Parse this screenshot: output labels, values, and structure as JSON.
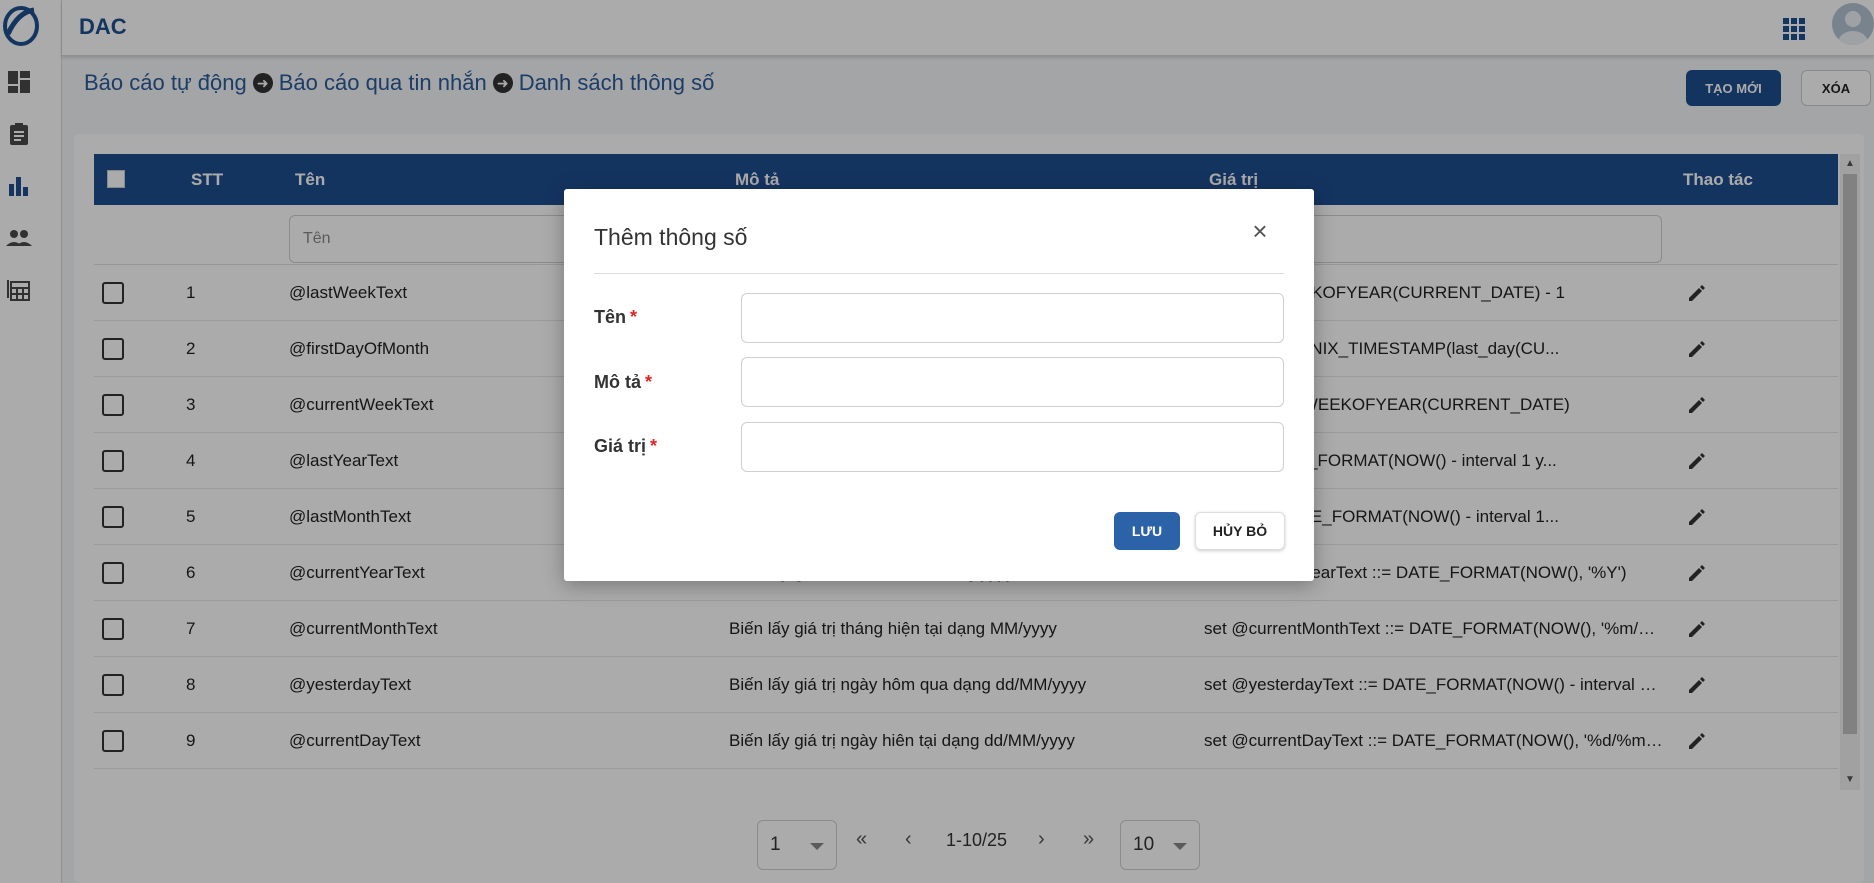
{
  "app": {
    "title": "DAC"
  },
  "breadcrumb": [
    "Báo cáo tự động",
    "Báo cáo qua tin nhắn",
    "Danh sách thông số"
  ],
  "toolbar": {
    "new_label": "TẠO MỚI",
    "delete_label": "XÓA"
  },
  "table": {
    "headers": {
      "stt": "STT",
      "name": "Tên",
      "desc": "Mô tả",
      "value": "Giá trị",
      "actions": "Thao tác"
    },
    "filter_placeholders": {
      "name": "Tên"
    },
    "rows": [
      {
        "stt": "1",
        "name": "@lastWeekText",
        "desc": "",
        "value": "kText ::= WEEKOFYEAR(CURRENT_DATE) - 1"
      },
      {
        "stt": "2",
        "name": "@firstDayOfMonth",
        "desc": "",
        "value": "OfMonth ::= UNIX_TIMESTAMP(last_day(CU..."
      },
      {
        "stt": "3",
        "name": "@currentWeekText",
        "desc": "",
        "value": "VeekText ::= WEEKOFYEAR(CURRENT_DATE)"
      },
      {
        "stt": "4",
        "name": "@lastYearText",
        "desc": "",
        "value": "Text ::= DATE_FORMAT(NOW() - interval 1 y..."
      },
      {
        "stt": "5",
        "name": "@lastMonthText",
        "desc": "",
        "value": "thText ::= DATE_FORMAT(NOW() - interval 1..."
      },
      {
        "stt": "6",
        "name": "@currentYearText",
        "desc": "Biến lấy giá trị năm hiện tại dạng yyyy",
        "value": "set @currentYearText ::= DATE_FORMAT(NOW(), '%Y')"
      },
      {
        "stt": "7",
        "name": "@currentMonthText",
        "desc": "Biến lấy giá trị tháng hiện tại dạng MM/yyyy",
        "value": "set @currentMonthText ::= DATE_FORMAT(NOW(), '%m/%..."
      },
      {
        "stt": "8",
        "name": "@yesterdayText",
        "desc": "Biến lấy giá trị ngày hôm qua dạng dd/MM/yyyy",
        "value": "set @yesterdayText ::= DATE_FORMAT(NOW() - interval 1 ..."
      },
      {
        "stt": "9",
        "name": "@currentDayText",
        "desc": "Biến lấy giá trị ngày hiên tại dạng dd/MM/yyyy",
        "value": "set @currentDayText ::= DATE_FORMAT(NOW(), '%d/%m/..."
      }
    ]
  },
  "pagination": {
    "page": "1",
    "info": "1-10/25",
    "page_size": "10",
    "first": "«",
    "prev": "‹",
    "next": "›",
    "last": "»"
  },
  "modal": {
    "title": "Thêm thông số",
    "close": "×",
    "fields": [
      {
        "label": "Tên",
        "required": "*",
        "value": ""
      },
      {
        "label": "Mô tả",
        "required": "*",
        "value": ""
      },
      {
        "label": "Giá trị",
        "required": "*",
        "value": ""
      }
    ],
    "save_label": "LƯU",
    "cancel_label": "HỦY BỎ"
  },
  "colors": {
    "primary": "#1f4e8f",
    "required": "#e02424",
    "overlay": "rgba(0,0,0,0.33)"
  },
  "icons": [
    "logo-icon",
    "dashboard-icon",
    "clipboard-icon",
    "chart-icon",
    "users-icon",
    "table-icon",
    "apps-grid-icon",
    "avatar-icon",
    "edit-icon",
    "arrow-circle-right-icon",
    "close-icon"
  ]
}
